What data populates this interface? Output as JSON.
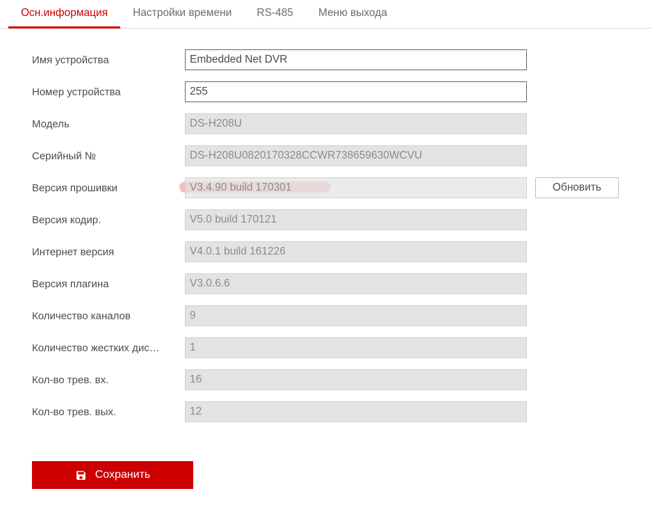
{
  "tabs": {
    "basic_info": "Осн.информация",
    "time_settings": "Настройки времени",
    "rs485": "RS-485",
    "logout_menu": "Меню выхода"
  },
  "form": {
    "device_name": {
      "label": "Имя устройства",
      "value": "Embedded Net DVR"
    },
    "device_number": {
      "label": "Номер устройства",
      "value": "255"
    },
    "model": {
      "label": "Модель",
      "value": "DS-H208U"
    },
    "serial": {
      "label": "Серийный №",
      "value": "DS-H208U0820170328CCWR738659630WCVU"
    },
    "firmware": {
      "label": "Версия прошивки",
      "value": "V3.4.90 build 170301"
    },
    "encoding": {
      "label": "Версия кодир.",
      "value": "V5.0 build 170121"
    },
    "web": {
      "label": "Интернет версия",
      "value": "V4.0.1 build 161226"
    },
    "plugin": {
      "label": "Версия плагина",
      "value": "V3.0.6.6"
    },
    "channels": {
      "label": "Количество каналов",
      "value": "9"
    },
    "hdd": {
      "label": "Количество жестких дис…",
      "value": "1"
    },
    "alarm_in": {
      "label": "Кол-во трев. вх.",
      "value": "16"
    },
    "alarm_out": {
      "label": "Кол-во трев. вых.",
      "value": "12"
    }
  },
  "buttons": {
    "update": "Обновить",
    "save": "Сохранить"
  }
}
